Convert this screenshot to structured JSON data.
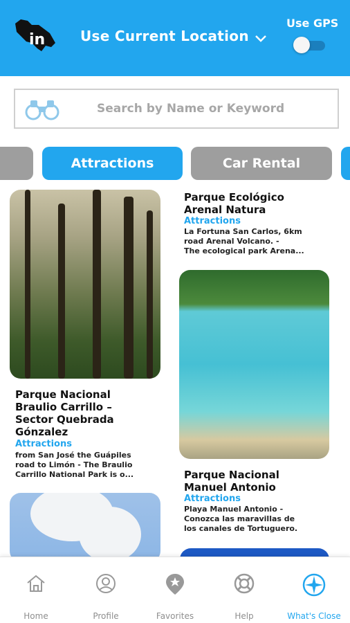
{
  "header": {
    "location_label": "Use Current Location",
    "gps_label": "Use GPS",
    "gps_enabled": false
  },
  "search": {
    "placeholder": "Search by Name or Keyword"
  },
  "categories": {
    "active": "Attractions",
    "next": "Car Rental"
  },
  "cards": [
    {
      "title": "Parque Nacional Braulio Carrillo – Sector Quebrada Gónzalez",
      "title_lines": [
        "Parque Nacional",
        "Braulio Carrillo –",
        "Sector Quebrada",
        "Gónzalez"
      ],
      "category": "Attractions",
      "desc_lines": [
        "from San José the Guápiles",
        "road to Limón - The Braulio",
        "Carrillo National Park is o..."
      ]
    },
    {
      "title": "Parque Ecológico Arenal Natura",
      "title_lines": [
        "Parque Ecológico",
        "Arenal Natura"
      ],
      "category": "Attractions",
      "desc_lines": [
        "La Fortuna San Carlos, 6km",
        "road Arenal Volcano. -",
        "The ecological park Arena..."
      ]
    },
    {
      "title": "Parque Nacional Manuel Antonio",
      "title_lines": [
        "Parque Nacional",
        "Manuel Antonio"
      ],
      "category": "Attractions",
      "desc_lines": [
        "Playa Manuel Antonio -",
        "Conozca las maravillas de",
        "los canales de Tortuguero."
      ]
    }
  ],
  "nav": [
    {
      "label": "Home",
      "icon": "home-icon"
    },
    {
      "label": "Profile",
      "icon": "profile-icon"
    },
    {
      "label": "Favorites",
      "icon": "favorites-icon"
    },
    {
      "label": "Help",
      "icon": "lifebuoy-icon"
    },
    {
      "label": "What's Close",
      "icon": "compass-icon",
      "active": true
    }
  ],
  "colors": {
    "brand_blue": "#22a6ee",
    "chip_gray": "#9e9e9e"
  }
}
